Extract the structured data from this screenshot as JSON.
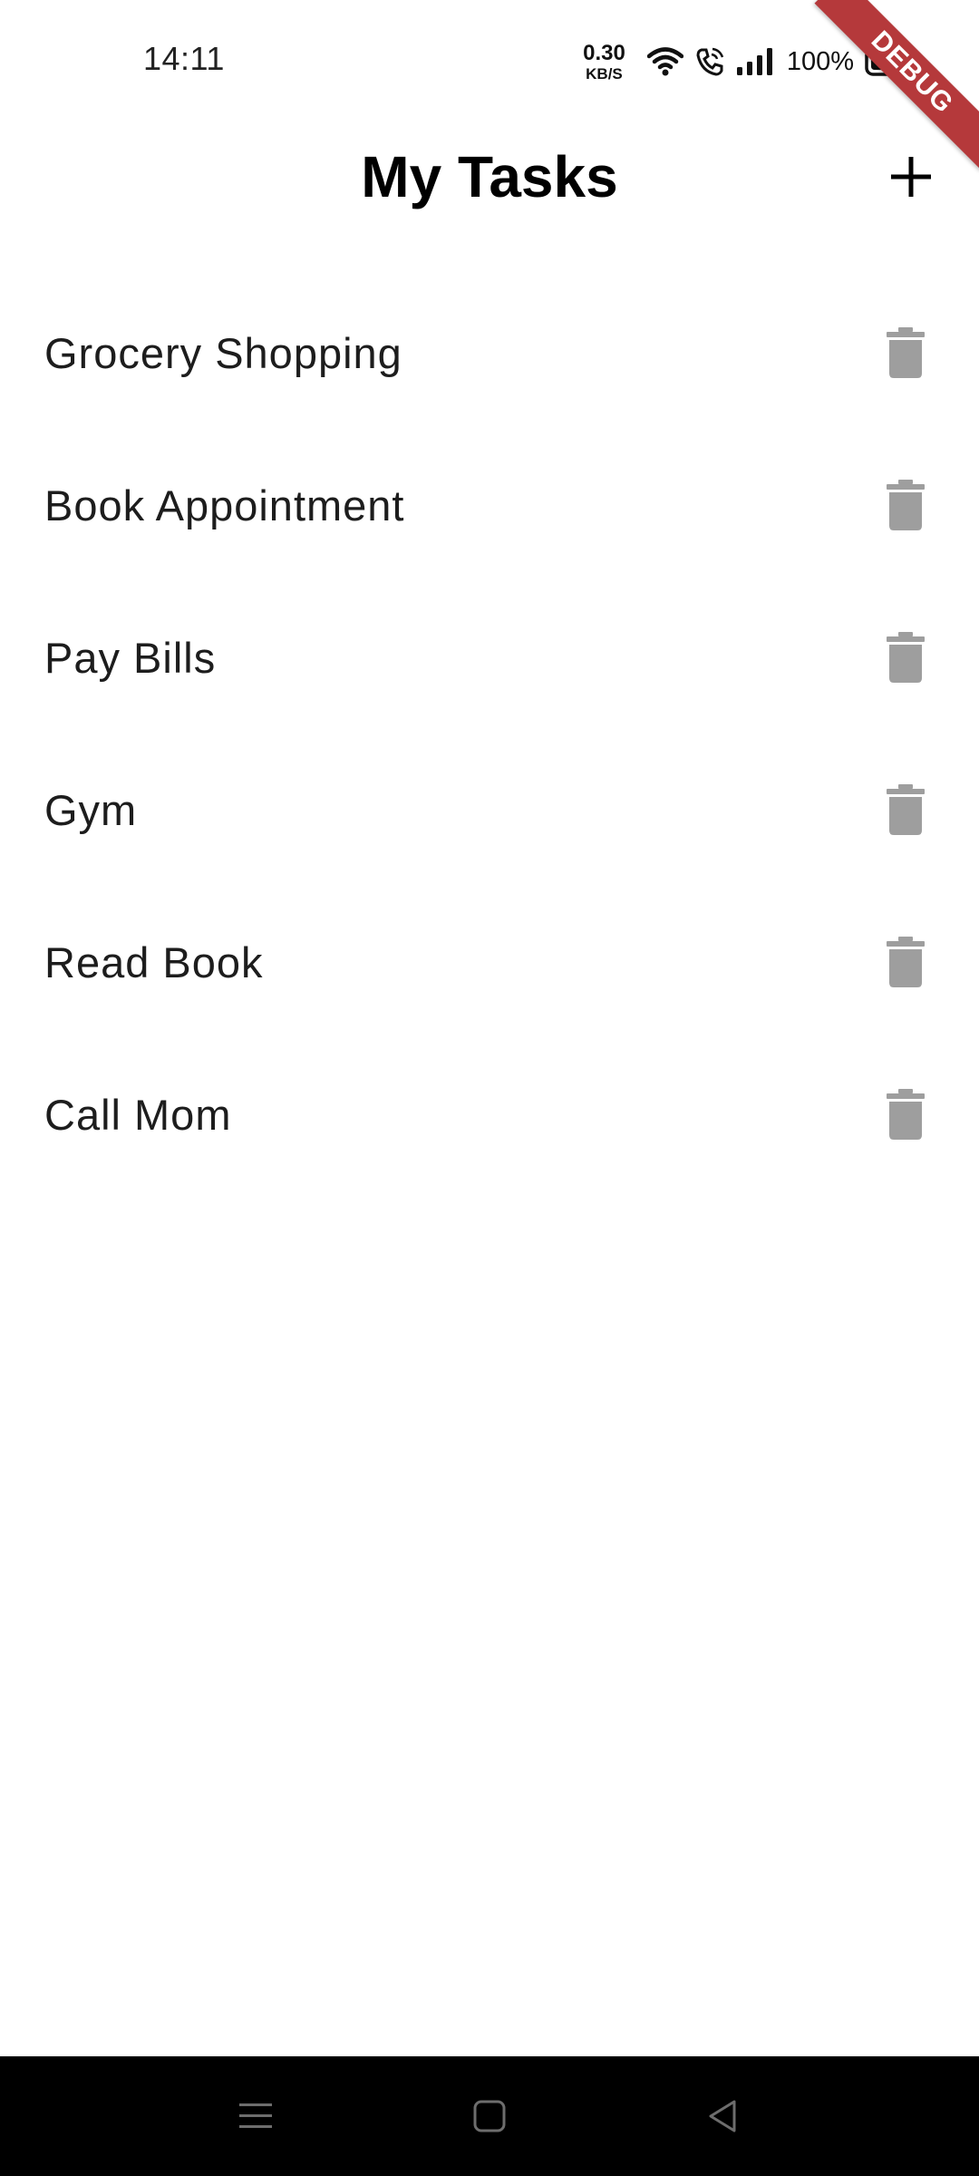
{
  "status_bar": {
    "time": "14:11",
    "net_speed_value": "0.30",
    "net_speed_unit": "KB/S",
    "battery_percent": "100%"
  },
  "debug_banner": "DEBUG",
  "app_bar": {
    "title": "My Tasks",
    "add_icon": "plus-icon"
  },
  "tasks": [
    {
      "label": "Grocery Shopping",
      "icon": "trash-icon"
    },
    {
      "label": "Book Appointment",
      "icon": "trash-icon"
    },
    {
      "label": "Pay Bills",
      "icon": "trash-icon"
    },
    {
      "label": "Gym",
      "icon": "trash-icon"
    },
    {
      "label": "Read Book",
      "icon": "trash-icon"
    },
    {
      "label": "Call Mom",
      "icon": "trash-icon"
    }
  ],
  "nav_bar": {
    "buttons": [
      "menu-icon",
      "home-icon",
      "back-icon"
    ]
  },
  "colors": {
    "background": "#ffffff",
    "text": "#1d1d1d",
    "trash_icon": "#9e9e9e",
    "debug_ribbon": "#b5393b",
    "nav_bar": "#000000",
    "nav_icons": "#6d6d6d"
  }
}
